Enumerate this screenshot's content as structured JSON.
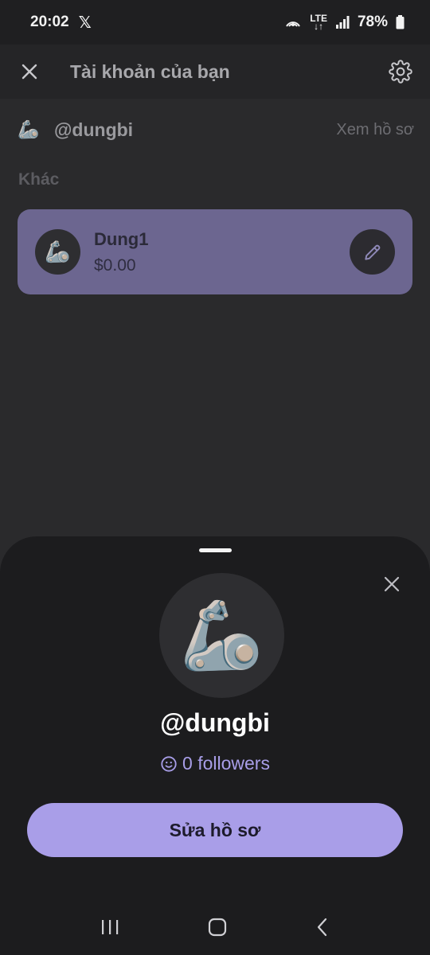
{
  "status": {
    "time": "20:02",
    "x_logo": "𝕏",
    "network_top": "LTE",
    "network_bottom": "↓↑",
    "battery": "78%"
  },
  "appbar": {
    "title": "Tài khoản của bạn",
    "icons": [
      "close-icon",
      "gear-icon"
    ]
  },
  "user_row": {
    "emoji": "🦾",
    "handle": "@dungbi",
    "view_label": "Xem hồ sơ"
  },
  "section": {
    "label": "Khác"
  },
  "account_card": {
    "emoji": "🦾",
    "name": "Dung1",
    "balance": "$0.00",
    "icons": [
      "pencil-icon"
    ]
  },
  "sheet": {
    "emoji": "🦾",
    "handle": "@dungbi",
    "followers": "0 followers",
    "edit_button": "Sửa hồ sơ",
    "icons": [
      "close-icon",
      "smile-icon"
    ]
  },
  "colors": {
    "card": "#6c6690",
    "accent": "#a99ee8",
    "sheet": "#1c1c1e"
  }
}
